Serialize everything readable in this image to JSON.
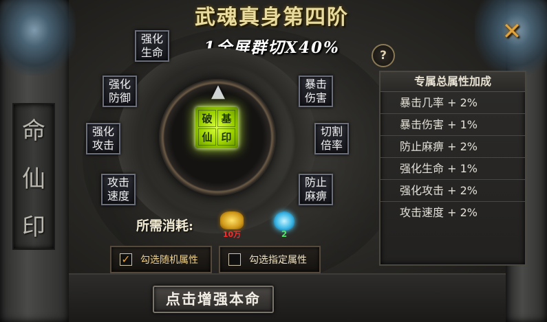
{
  "title": "武魂真身第四阶",
  "subtitle": "1全屏群切X40%",
  "close_glyph": "✕",
  "help_glyph": "?",
  "pillar_text": [
    "命",
    "仙",
    "印"
  ],
  "seal_chars": [
    "破",
    "基",
    "仙",
    "印"
  ],
  "emblem_glyph": "▲",
  "attribute_buttons": [
    {
      "label": "强化\n生命"
    },
    {
      "label": "强化\n防御"
    },
    {
      "label": "强化\n攻击"
    },
    {
      "label": "攻击\n速度"
    },
    {
      "label": "暴击\n伤害"
    },
    {
      "label": "切割\n倍率"
    },
    {
      "label": "防止\n麻痹"
    }
  ],
  "cost": {
    "label": "所需消耗:",
    "gold_value": "10万",
    "soul_value": "2",
    "gold_icon": "gold-ingot-icon",
    "soul_icon": "blue-flame-icon"
  },
  "choices": [
    {
      "label": "勾选随机属性",
      "checked": true,
      "check_glyph": "✓"
    },
    {
      "label": "勾选指定属性",
      "checked": false,
      "check_glyph": ""
    }
  ],
  "main_button": "点击增强本命",
  "panel": {
    "header": "专属总属性加成",
    "rows": [
      "暴击几率 + 2%",
      "暴击伤害 + 1%",
      "防止麻痹 + 2%",
      "强化生命 + 1%",
      "强化攻击 + 2%",
      "攻击速度 + 2%"
    ]
  },
  "colors": {
    "title_gold": "#e9dca0",
    "close_orange": "#e0a23a",
    "seal_green": "#9bd000",
    "gold_value_red": "#ff2a2a",
    "soul_value_green": "#4fe36a"
  }
}
